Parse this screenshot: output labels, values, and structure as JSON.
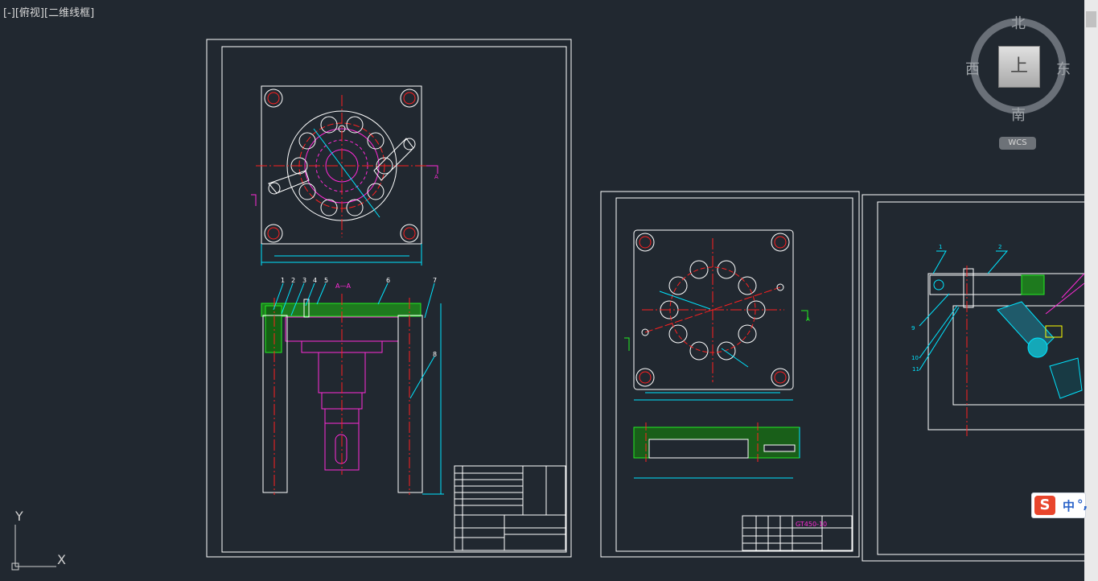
{
  "viewport": {
    "control_label": "[-]",
    "view_label": "[俯视]",
    "style_label": "[二维线框]"
  },
  "viewcube": {
    "north": "北",
    "south": "南",
    "east": "东",
    "west": "西",
    "face": "上",
    "wcs_label": "WCS"
  },
  "ucs": {
    "x_label": "X",
    "y_label": "Y"
  },
  "drawing1": {
    "section_label": "A—A",
    "balloons": [
      "1",
      "2",
      "3",
      "4",
      "5",
      "6",
      "7",
      "8"
    ],
    "view_marker": "A"
  },
  "drawing2": {
    "title_code": "GT450-10",
    "view_marker": "A"
  },
  "drawing3": {
    "balloons": [
      "1",
      "2",
      "9",
      "10",
      "11"
    ]
  },
  "ime": {
    "logo": "S",
    "language": "中",
    "punctuation": "°,"
  },
  "colors": {
    "background": "#212830",
    "line_white": "#ffffff",
    "line_cyan": "#00e5ff",
    "line_magenta": "#ff2bd7",
    "line_red": "#ff2020",
    "line_green": "#22ee22",
    "line_yellow": "#ffff00"
  }
}
